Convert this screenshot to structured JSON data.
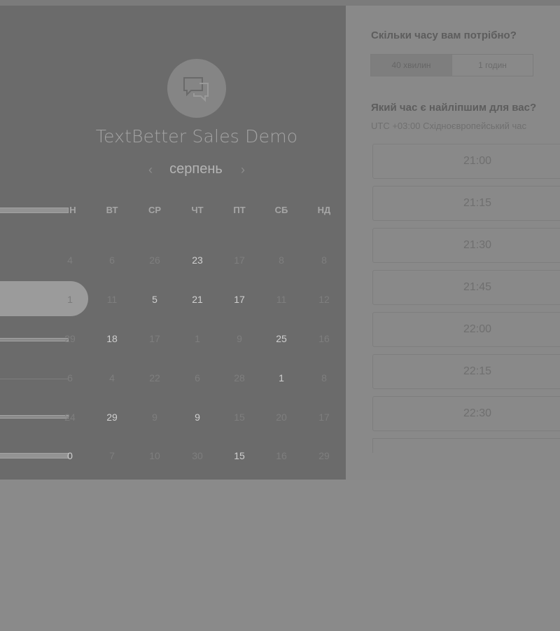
{
  "calendar": {
    "app_title": "TextBetter Sales Demo",
    "month": "серпень",
    "prev_icon": "‹",
    "next_icon": "›",
    "weekdays": [
      "Н",
      "ВТ",
      "СР",
      "ЧТ",
      "ПТ",
      "СБ",
      "НД"
    ],
    "weeks": [
      [
        "4",
        "6",
        "26",
        "23",
        "17",
        "8",
        "8"
      ],
      [
        "1",
        "11",
        "5",
        "21",
        "17",
        "11",
        "12"
      ],
      [
        "29",
        "18",
        "17",
        "1",
        "9",
        "25",
        "16"
      ],
      [
        "6",
        "4",
        "22",
        "6",
        "28",
        "1",
        "8"
      ],
      [
        "24",
        "29",
        "9",
        "9",
        "15",
        "20",
        "17"
      ],
      [
        "0",
        "7",
        "10",
        "30",
        "15",
        "16",
        "29"
      ]
    ]
  },
  "booking": {
    "duration_question": "Скільки часу вам потрібно?",
    "durations": [
      "40 хвилин",
      "1 годин"
    ],
    "time_question": "Який час є найліпшим для вас?",
    "timezone": "UTC +03:00 Східноєвропейський час",
    "slots": [
      "21:00",
      "21:15",
      "21:30",
      "21:45",
      "22:00",
      "22:15",
      "22:30"
    ]
  }
}
